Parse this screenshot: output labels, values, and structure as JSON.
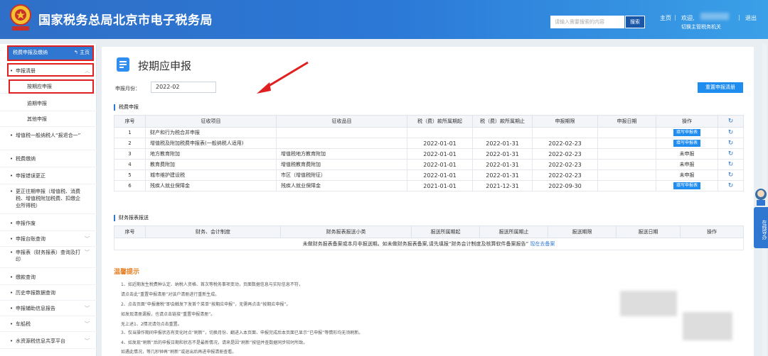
{
  "header": {
    "site_title": "国家税务总局北京市电子税务局",
    "search_placeholder": "请输入需要搜索的内容",
    "search_btn": "搜索",
    "home": "主页",
    "welcome": "欢迎,",
    "switch": "切换主管税务机关",
    "logout": "退出"
  },
  "sidebar": {
    "head": "税费申报及缴纳",
    "head_home": "主页",
    "items": [
      {
        "label": "申报清册",
        "expand": true
      },
      {
        "label": "增值税一般纳税人“报退合一”",
        "expand": false
      },
      {
        "label": "税费缴纳",
        "expand": false
      },
      {
        "label": "申报错误更正",
        "expand": false
      },
      {
        "label": "更正往期申报（增值税、消费税、增值税附加税费、扣缴企业所得税）",
        "expand": false
      },
      {
        "label": "申报作废",
        "expand": false
      },
      {
        "label": "申报台账查询",
        "expand": true
      },
      {
        "label": "申报表（财务报表）查询及打印",
        "expand": true
      },
      {
        "label": "缴款查询",
        "expand": false
      },
      {
        "label": "历史申报数据查询",
        "expand": false
      },
      {
        "label": "申报辅助信息报告",
        "expand": true
      },
      {
        "label": "车船税",
        "expand": true
      },
      {
        "label": "水资源税信息共享平台",
        "expand": true
      }
    ],
    "sub_items": [
      "按期应申报",
      "逾期申报",
      "其他申报"
    ]
  },
  "main": {
    "title": "按期应申报",
    "period_label": "申报月份：",
    "period_value": "2022-02",
    "reset_btn": "重置申报清册",
    "section1": "税费申报",
    "section2": "财务报表报送",
    "fee_table": {
      "headers": [
        "序号",
        "征收项目",
        "征收品目",
        "税（费）款所属期起",
        "税（费）款所属期止",
        "申报期限",
        "申报日期",
        "操作",
        "↻"
      ],
      "rows": [
        [
          "1",
          "财产和行为税合并申报",
          "",
          "",
          "",
          "",
          "",
          "填写申报表",
          "↻"
        ],
        [
          "2",
          "增值税及附加税费申报表(一般纳税人适用)",
          "",
          "2022-01-01",
          "2022-01-31",
          "2022-02-23",
          "",
          "填写申报表",
          "↻"
        ],
        [
          "3",
          "地方教育附加",
          "增值税地方教育附加",
          "2022-01-01",
          "2022-01-31",
          "2022-02-23",
          "",
          "未申报",
          "↻"
        ],
        [
          "4",
          "教育费附加",
          "增值税教育费附加",
          "2022-01-01",
          "2022-01-31",
          "2022-02-23",
          "",
          "未申报",
          "↻"
        ],
        [
          "5",
          "城市维护建设税",
          "市区（增值税附征）",
          "2022-01-01",
          "2022-01-31",
          "2022-02-23",
          "",
          "未申报",
          "↻"
        ],
        [
          "6",
          "残疾人就业保障金",
          "残疾人就业保障金",
          "2021-01-01",
          "2021-12-31",
          "2022-09-30",
          "",
          "填写申报表",
          "↻"
        ]
      ]
    },
    "fin_table": {
      "headers": [
        "序号",
        "财务、会计制度",
        "财务报表报送小类",
        "报送所属期起",
        "报送所属期止",
        "报送期限",
        "报送日期",
        "操作"
      ],
      "empty_text": "未做财务报表备案或本月非报送期。如未做财务报表备案,请先填报“财务会计制度及核算软件备案报告”",
      "empty_link": "现在去备案"
    },
    "tips_title": "温馨提示",
    "tips": [
      "1、如近期发生税费种认定、纳税人资格、首次等税务事项变动，页面数据信息与实际信息不符，",
      "请点击此“重置申报清册”对该户清册进行重新生成。",
      "2、点击页面“申报缴税”即会触发下发首个菜单“按期应申报”，无需再点击“按期应申报”。",
      "如发现清册漏报，也请点击链接“重置申报清册”。",
      "无上述1、2情况请勿点击重置。",
      "3、仅当操作期间申报状态有变化时点“刷新”，切换月份、翻进入本页面、申报完成后本页面已显示“已申报”等情形均无须刷新。",
      "4、如发现“刷新”后的申报日期和状态不是最新情况，请来是因“刷新”按钮并查数据同步较时所致。",
      "如遇此情况，等几秒钟再“刷新”或退出后再进申报清册查看。"
    ],
    "tip_link": "重置申报清册"
  },
  "float_tab": "在线导办",
  "colors": {
    "brand": "#2f77d1",
    "button": "#1f8cf0",
    "alert": "#e02020",
    "tips": "#e67e22"
  }
}
